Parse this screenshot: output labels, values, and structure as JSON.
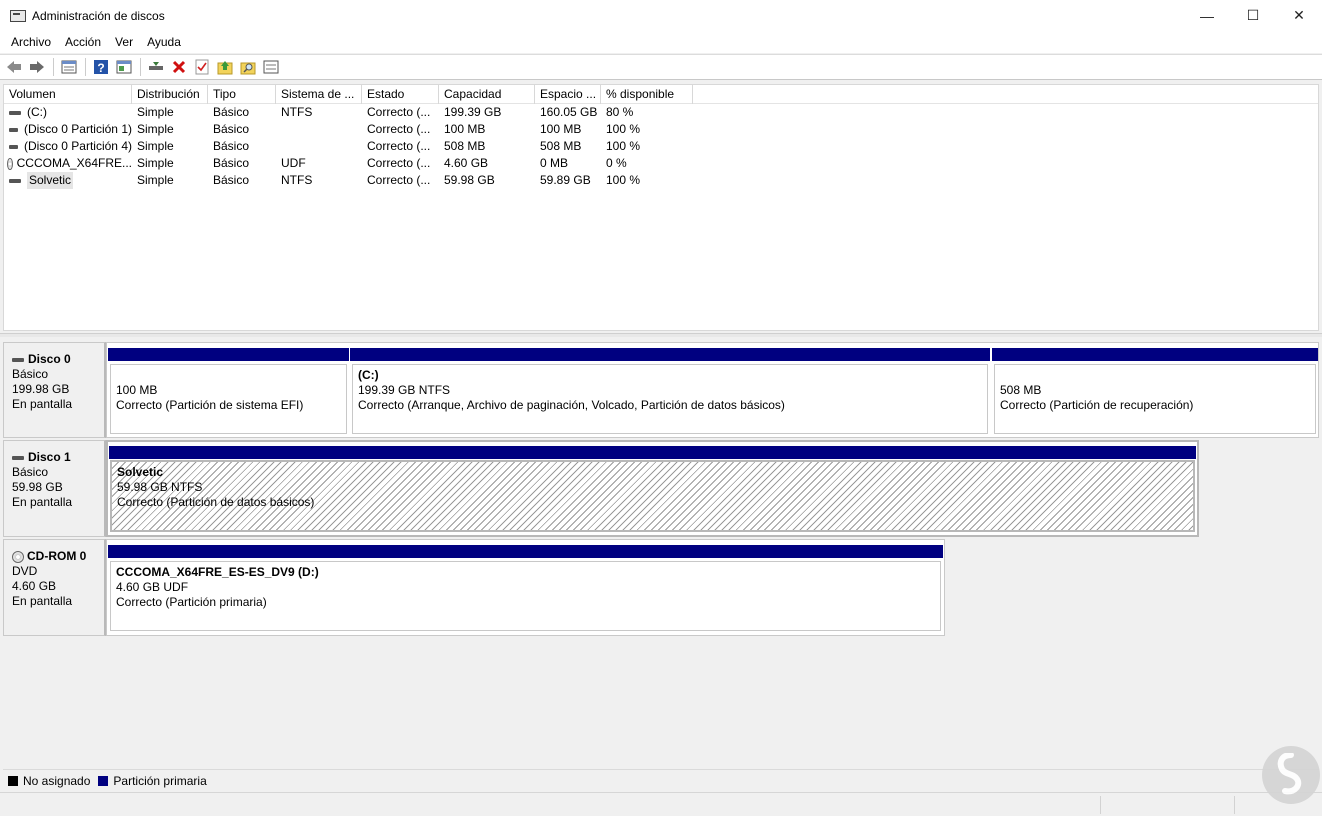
{
  "window": {
    "title": "Administración de discos",
    "controls": [
      "—",
      "☐",
      "✕"
    ]
  },
  "menu": [
    "Archivo",
    "Acción",
    "Ver",
    "Ayuda"
  ],
  "toolbar": {
    "icons": [
      "back-arrow-icon",
      "forward-arrow-icon",
      "volume-list-icon",
      "help-icon",
      "properties-icon",
      "connect-drive-icon",
      "delete-icon",
      "check-icon",
      "folder-up-icon",
      "search-folder-icon",
      "settings-panel-icon"
    ]
  },
  "volume_table": {
    "columns": [
      "Volumen",
      "Distribución",
      "Tipo",
      "Sistema de ...",
      "Estado",
      "Capacidad",
      "Espacio ...",
      "% disponible"
    ],
    "rows": [
      {
        "icon": "drive",
        "name": "(C:)",
        "layout": "Simple",
        "type": "Básico",
        "fs": "NTFS",
        "status": "Correcto (...",
        "capacity": "199.39 GB",
        "free": "160.05 GB",
        "pct": "80 %"
      },
      {
        "icon": "drive",
        "name": "(Disco 0 Partición 1)",
        "layout": "Simple",
        "type": "Básico",
        "fs": "",
        "status": "Correcto (...",
        "capacity": "100 MB",
        "free": "100 MB",
        "pct": "100 %"
      },
      {
        "icon": "drive",
        "name": "(Disco 0 Partición 4)",
        "layout": "Simple",
        "type": "Básico",
        "fs": "",
        "status": "Correcto (...",
        "capacity": "508 MB",
        "free": "508 MB",
        "pct": "100 %"
      },
      {
        "icon": "cd",
        "name": "CCCOMA_X64FRE...",
        "layout": "Simple",
        "type": "Básico",
        "fs": "UDF",
        "status": "Correcto (...",
        "capacity": "4.60 GB",
        "free": "0 MB",
        "pct": "0 %"
      },
      {
        "icon": "drive",
        "name": "Solvetic",
        "layout": "Simple",
        "type": "Básico",
        "fs": "NTFS",
        "status": "Correcto (...",
        "capacity": "59.98 GB",
        "free": "59.89 GB",
        "pct": "100 %"
      }
    ]
  },
  "disks": [
    {
      "icon": "drive",
      "name": "Disco 0",
      "kind": "Básico",
      "size": "199.98 GB",
      "state": "En pantalla",
      "partitions": [
        {
          "title": "",
          "line1": "100 MB",
          "line2": "Correcto (Partición de sistema EFI)"
        },
        {
          "title": "(C:)",
          "line1": "199.39 GB NTFS",
          "line2": "Correcto (Arranque, Archivo de paginación, Volcado, Partición de datos básicos)"
        },
        {
          "title": "",
          "line1": "508 MB",
          "line2": "Correcto (Partición de recuperación)"
        }
      ]
    },
    {
      "icon": "drive",
      "name": "Disco 1",
      "kind": "Básico",
      "size": "59.98 GB",
      "state": "En pantalla",
      "partitions": [
        {
          "title": "Solvetic",
          "line1": "59.98 GB NTFS",
          "line2": "Correcto (Partición de datos básicos)"
        }
      ]
    },
    {
      "icon": "cd",
      "name": "CD-ROM 0",
      "kind": "DVD",
      "size": "4.60 GB",
      "state": "En pantalla",
      "partitions": [
        {
          "title": "CCCOMA_X64FRE_ES-ES_DV9  (D:)",
          "line1": "4.60 GB UDF",
          "line2": "Correcto (Partición primaria)"
        }
      ]
    }
  ],
  "legend": [
    {
      "label": "No asignado",
      "color": "#000000"
    },
    {
      "label": "Partición primaria",
      "color": "#000080"
    }
  ],
  "colors": {
    "primary_partition": "#000080",
    "selection": "#e5e5e5"
  }
}
